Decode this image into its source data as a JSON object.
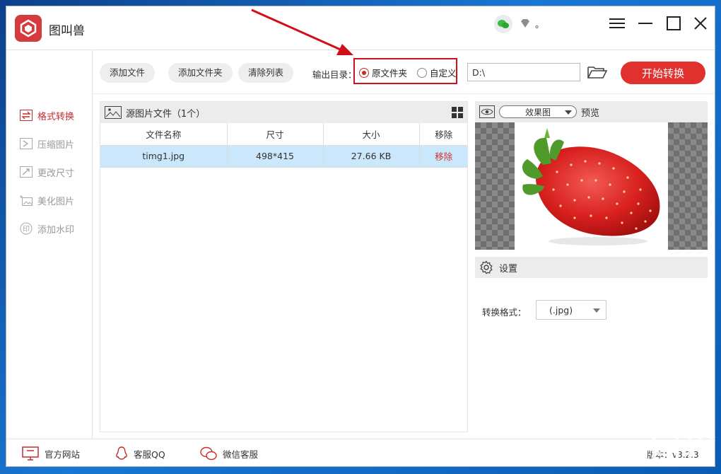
{
  "app": {
    "title": "图叫兽",
    "account_dot": "。"
  },
  "sidebar": {
    "items": [
      {
        "label": "格式转换",
        "active": true
      },
      {
        "label": "压缩图片",
        "active": false
      },
      {
        "label": "更改尺寸",
        "active": false
      },
      {
        "label": "美化图片",
        "active": false
      },
      {
        "label": "添加水印",
        "active": false
      }
    ]
  },
  "toolbar": {
    "add_file": "添加文件",
    "add_folder": "添加文件夹",
    "clear_list": "清除列表",
    "output_label": "输出目录：",
    "radio_original": "原文件夹",
    "radio_custom": "自定义",
    "path_value": "D:\\",
    "start_button": "开始转换"
  },
  "file_panel": {
    "title": "源图片文件（1个）",
    "columns": [
      "文件名称",
      "尺寸",
      "大小",
      "移除"
    ],
    "rows": [
      {
        "name": "timg1.jpg",
        "size": "498*415",
        "filesize": "27.66 KB",
        "remove": "移除"
      }
    ]
  },
  "preview": {
    "mode": "效果图",
    "label": "预览"
  },
  "settings": {
    "title": "设置",
    "format_label": "转换格式：",
    "format_value": "(.jpg)"
  },
  "statusbar": {
    "website": "官方网站",
    "qq": "客服QQ",
    "wechat": "微信客服",
    "version": "版本：v3.2.3"
  },
  "colors": {
    "accent": "#e0312f",
    "active_text": "#c62d2d",
    "selected_row": "#cbe7fb",
    "annotation": "#d10f1b"
  }
}
